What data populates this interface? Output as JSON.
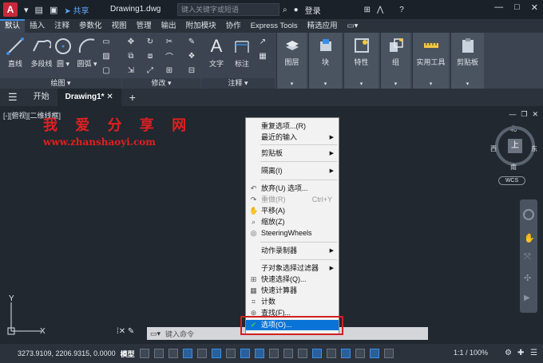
{
  "title_bar": {
    "logo": "A",
    "share_label": "共享",
    "document_title": "Drawing1.dwg",
    "search_placeholder": "键入关键字或短语",
    "login_label": "登录"
  },
  "ribbon_tabs": [
    "默认",
    "插入",
    "注释",
    "参数化",
    "视图",
    "管理",
    "输出",
    "附加模块",
    "协作",
    "Express Tools",
    "精选应用"
  ],
  "ribbon": {
    "draw_tools": [
      "直线",
      "多段线",
      "圆",
      "圆弧"
    ],
    "draw_group": "绘图",
    "modify_group": "修改",
    "annotation_tools": [
      "文字",
      "标注"
    ],
    "annotation_group": "注释",
    "panels": [
      "图层",
      "块",
      "特性",
      "组",
      "实用工具",
      "剪贴板"
    ]
  },
  "file_tabs": {
    "start": "开始",
    "drawing": "Drawing1*"
  },
  "canvas": {
    "view_label": "[-][俯视][二维线框]",
    "watermark_title": "我 爱 分 享 网",
    "watermark_url": "www.zhanshaoyi.com"
  },
  "context_menu": {
    "items": [
      {
        "label": "重复选项...(R)",
        "arrow": false
      },
      {
        "label": "最近的输入",
        "arrow": true
      },
      {
        "label": "剪贴板",
        "arrow": true
      },
      {
        "label": "隔离(I)",
        "arrow": true
      },
      {
        "label": "放弃(U) 选项...",
        "arrow": false
      },
      {
        "label": "重做(R)",
        "shortcut": "Ctrl+Y",
        "disabled": true
      },
      {
        "label": "平移(A)",
        "arrow": false
      },
      {
        "label": "缩放(Z)",
        "arrow": false
      },
      {
        "label": "SteeringWheels",
        "arrow": false
      },
      {
        "label": "动作录制器",
        "arrow": true
      },
      {
        "label": "子对象选择过滤器",
        "arrow": true
      },
      {
        "label": "快速选择(Q)...",
        "arrow": false
      },
      {
        "label": "快速计算器",
        "arrow": false
      },
      {
        "label": "计数",
        "arrow": false
      },
      {
        "label": "查找(F)...",
        "arrow": false
      },
      {
        "label": "选项(O)...",
        "arrow": false,
        "highlighted": true
      }
    ]
  },
  "nav_cube": {
    "north": "北",
    "south": "南",
    "east": "东",
    "west": "西",
    "top": "上",
    "wcs": "WCS"
  },
  "command_line": {
    "placeholder": "键入命令"
  },
  "status_bar": {
    "coordinates": "3273.9109, 2206.9315, 0.0000",
    "model": "模型",
    "zoom": "1:1 / 100%"
  },
  "colors": {
    "accent": "#0a74d6",
    "watermark": "#e02020",
    "highlight_box": "#d02020"
  }
}
